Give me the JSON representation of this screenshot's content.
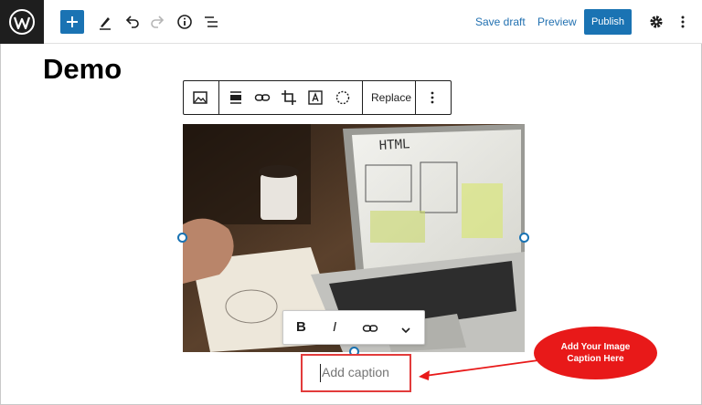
{
  "header": {
    "save_draft_label": "Save draft",
    "preview_label": "Preview",
    "publish_label": "Publish"
  },
  "post": {
    "title": "Demo"
  },
  "block_toolbar": {
    "replace_label": "Replace"
  },
  "format_toolbar": {
    "bold_label": "B",
    "italic_label": "I"
  },
  "caption": {
    "placeholder": "Add caption"
  },
  "annotation": {
    "line1": "Add Your Image",
    "line2": "Caption Here"
  },
  "colors": {
    "accent": "#1a73b3",
    "annotation": "#e81919",
    "dark": "#1e1e1e"
  }
}
